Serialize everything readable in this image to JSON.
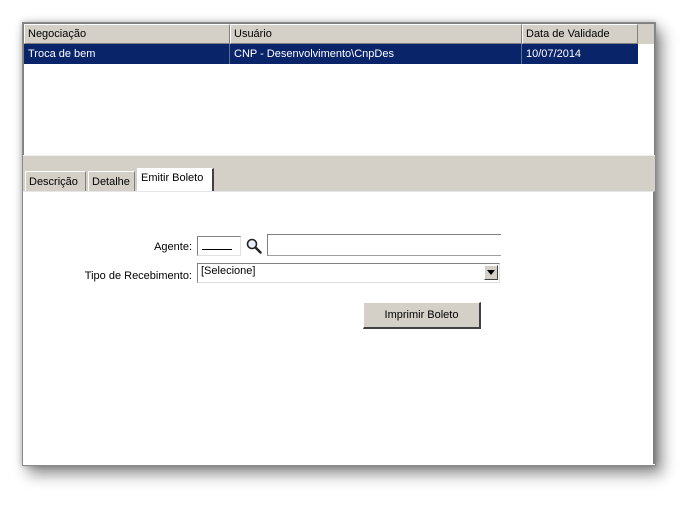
{
  "grid": {
    "columns": [
      "Negociação",
      "Usuário",
      "Data de Validade"
    ],
    "rows": [
      {
        "negociacao": "Troca de bem",
        "usuario": "CNP - Desenvolvimento\\CnpDes",
        "data_validade": "10/07/2014"
      }
    ]
  },
  "tabs": [
    {
      "label": "Descrição"
    },
    {
      "label": "Detalhe"
    },
    {
      "label": "Emitir Boleto",
      "active": true
    }
  ],
  "form": {
    "agente_label": "Agente:",
    "agente_code": "",
    "agente_name": "",
    "tipo_label": "Tipo de Recebimento:",
    "tipo_value": "[Selecione]",
    "print_button": "Imprimir Boleto"
  },
  "icons": {
    "search": "magnifier-icon",
    "dropdown": "chevron-down-icon"
  }
}
